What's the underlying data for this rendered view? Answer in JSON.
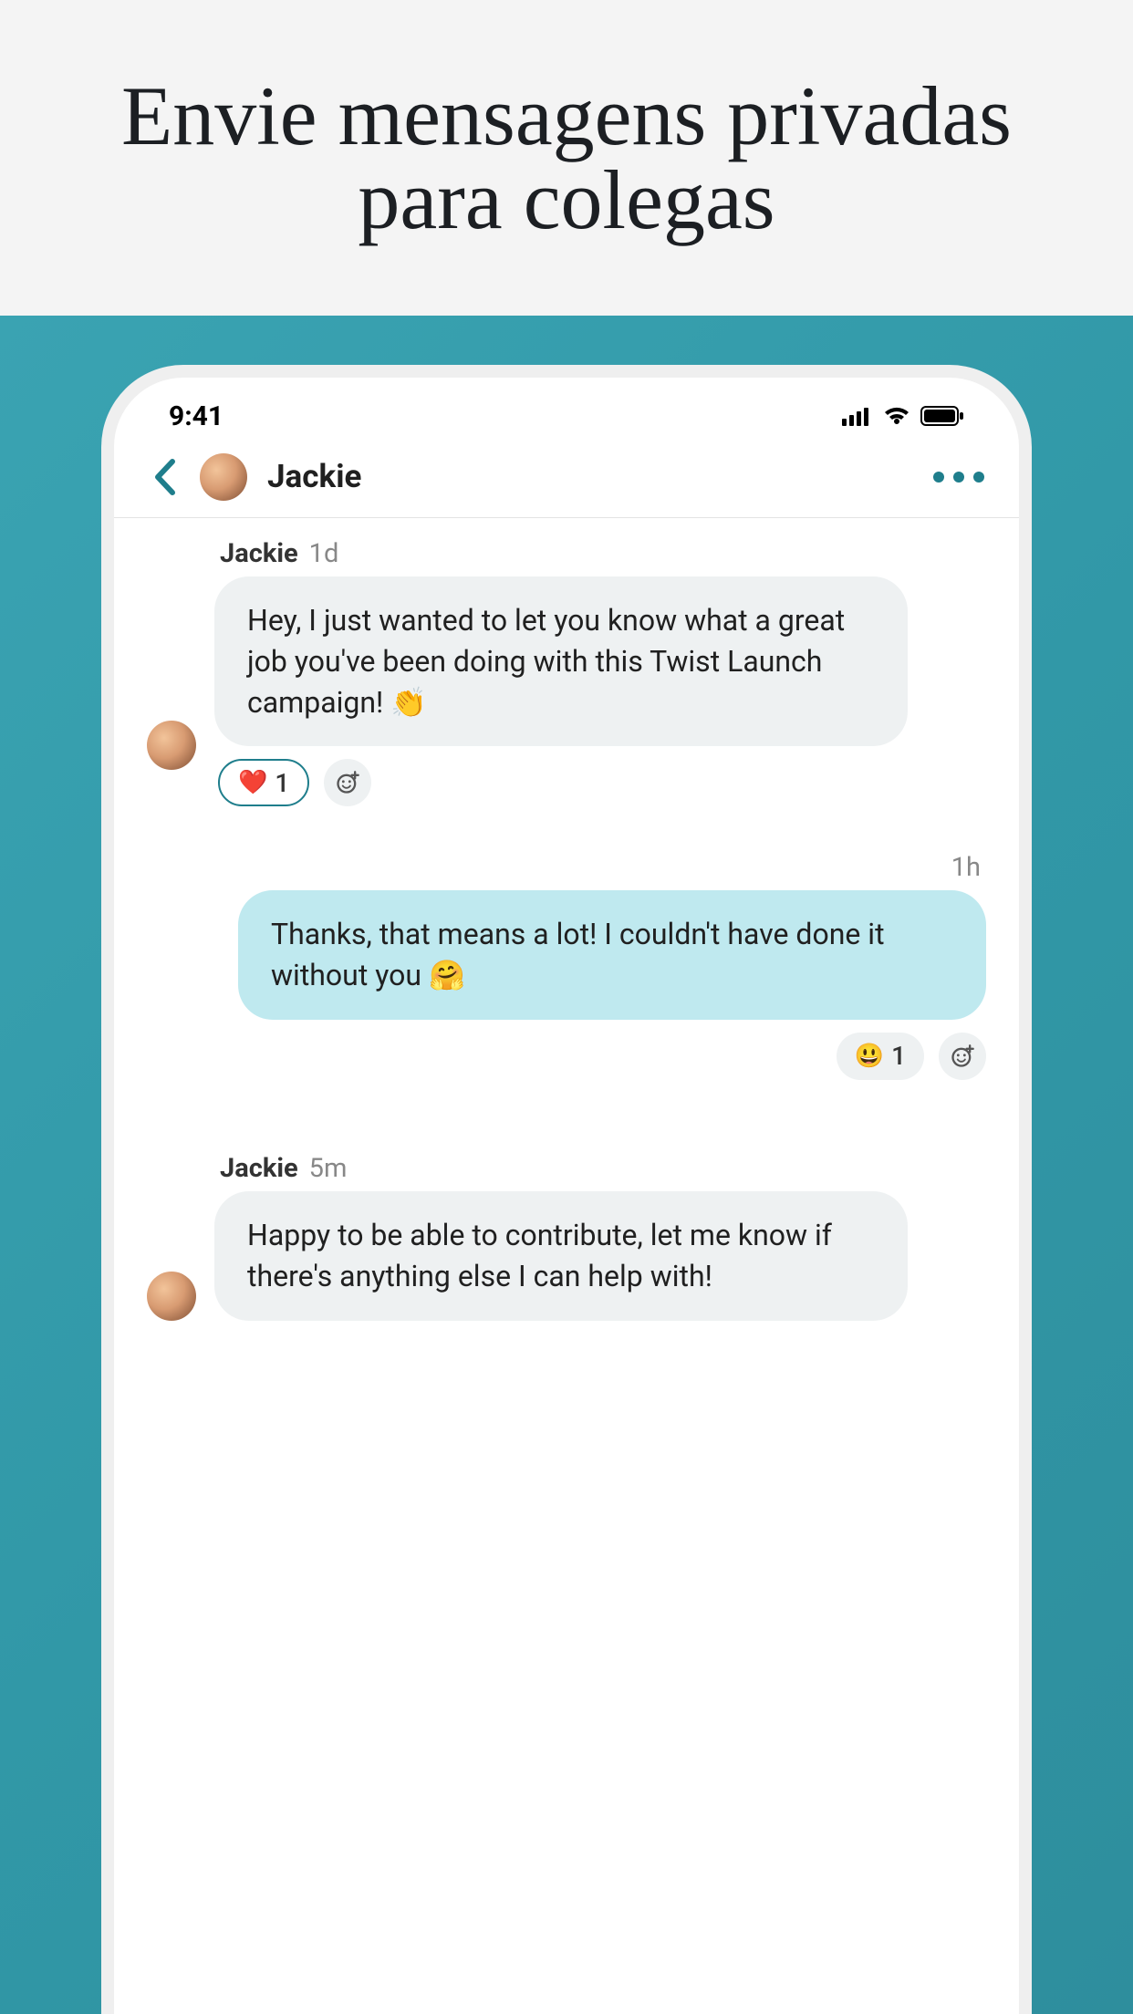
{
  "promo": {
    "headline": "Envie mensagens privadas para colegas"
  },
  "status": {
    "time": "9:41"
  },
  "header": {
    "contact_name": "Jackie"
  },
  "messages": [
    {
      "side": "left",
      "author": "Jackie",
      "time": "1d",
      "text": "Hey, I just wanted to let you know what a great job you've been doing with this Twist Launch campaign! 👏",
      "reactions": [
        {
          "emoji": "❤️",
          "count": "1",
          "active": true
        }
      ]
    },
    {
      "side": "right",
      "time": "1h",
      "text": "Thanks, that means a lot! I couldn't have done it without you 🤗",
      "reactions": [
        {
          "emoji": "😃",
          "count": "1",
          "active": false
        }
      ]
    },
    {
      "side": "left",
      "author": "Jackie",
      "time": "5m",
      "text": "Happy to be able to contribute, let me know if there's anything else I can help with!",
      "reactions": []
    }
  ]
}
